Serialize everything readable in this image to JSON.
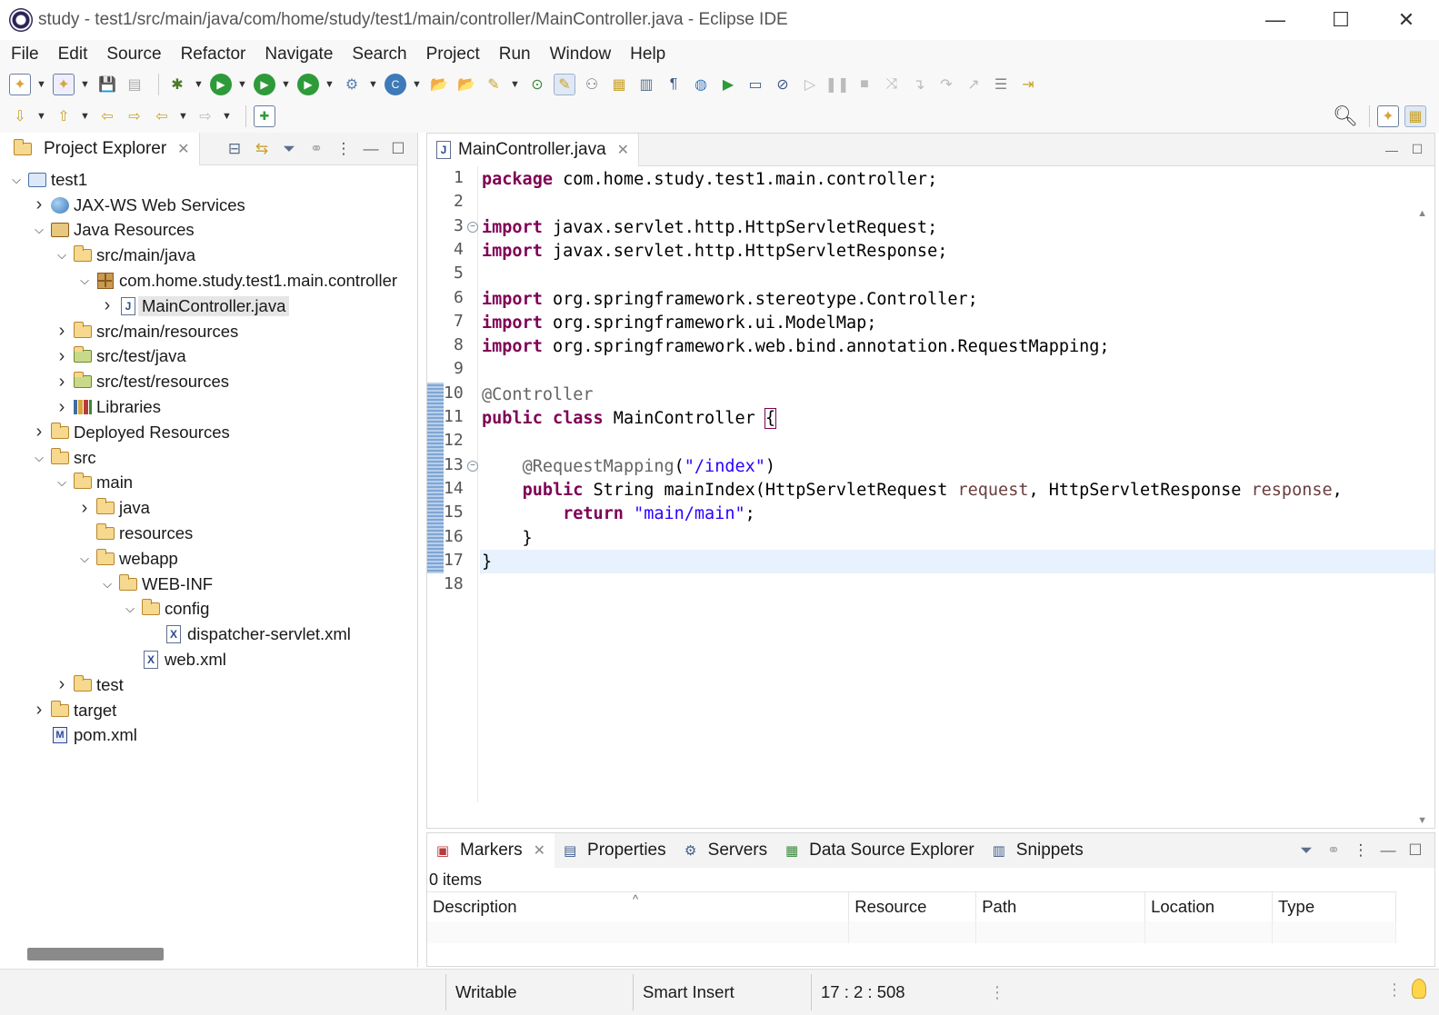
{
  "window": {
    "title": "study - test1/src/main/java/com/home/study/test1/main/controller/MainController.java - Eclipse IDE",
    "minimize": "—",
    "maximize": "☐",
    "close": "✕"
  },
  "menu": [
    "File",
    "Edit",
    "Source",
    "Refactor",
    "Navigate",
    "Search",
    "Project",
    "Run",
    "Window",
    "Help"
  ],
  "project_explorer": {
    "tab_label": "Project Explorer",
    "tree": [
      {
        "label": "test1",
        "indent": 0,
        "twisty": "open",
        "icon": "project-icon"
      },
      {
        "label": "JAX-WS Web Services",
        "indent": 1,
        "twisty": "closed",
        "icon": "web-services-icon"
      },
      {
        "label": "Java Resources",
        "indent": 1,
        "twisty": "open",
        "icon": "java-resources-icon"
      },
      {
        "label": "src/main/java",
        "indent": 2,
        "twisty": "open",
        "icon": "source-folder-icon"
      },
      {
        "label": "com.home.study.test1.main.controller",
        "indent": 3,
        "twisty": "open",
        "icon": "package-icon"
      },
      {
        "label": "MainController.java",
        "indent": 4,
        "twisty": "closed",
        "icon": "java-file-icon",
        "selected": true
      },
      {
        "label": "src/main/resources",
        "indent": 2,
        "twisty": "closed",
        "icon": "source-folder-icon"
      },
      {
        "label": "src/test/java",
        "indent": 2,
        "twisty": "closed",
        "icon": "test-source-folder-icon"
      },
      {
        "label": "src/test/resources",
        "indent": 2,
        "twisty": "closed",
        "icon": "test-source-folder-icon"
      },
      {
        "label": "Libraries",
        "indent": 2,
        "twisty": "closed",
        "icon": "libraries-icon"
      },
      {
        "label": "Deployed Resources",
        "indent": 1,
        "twisty": "closed",
        "icon": "folder-icon"
      },
      {
        "label": "src",
        "indent": 1,
        "twisty": "open",
        "icon": "folder-icon"
      },
      {
        "label": "main",
        "indent": 2,
        "twisty": "open",
        "icon": "folder-icon"
      },
      {
        "label": "java",
        "indent": 3,
        "twisty": "closed",
        "icon": "folder-icon"
      },
      {
        "label": "resources",
        "indent": 3,
        "twisty": "none",
        "icon": "folder-icon"
      },
      {
        "label": "webapp",
        "indent": 3,
        "twisty": "open",
        "icon": "folder-icon"
      },
      {
        "label": "WEB-INF",
        "indent": 4,
        "twisty": "open",
        "icon": "folder-icon"
      },
      {
        "label": "config",
        "indent": 5,
        "twisty": "open",
        "icon": "folder-icon"
      },
      {
        "label": "dispatcher-servlet.xml",
        "indent": 6,
        "twisty": "none",
        "icon": "xml-file-icon"
      },
      {
        "label": "web.xml",
        "indent": 5,
        "twisty": "none",
        "icon": "xml-file-icon"
      },
      {
        "label": "test",
        "indent": 2,
        "twisty": "closed",
        "icon": "folder-icon"
      },
      {
        "label": "target",
        "indent": 1,
        "twisty": "closed",
        "icon": "folder-icon"
      },
      {
        "label": "pom.xml",
        "indent": 1,
        "twisty": "none",
        "icon": "maven-file-icon"
      }
    ]
  },
  "editor": {
    "tab_label": "MainController.java",
    "lines": [
      {
        "n": "1",
        "fold": false,
        "tokens": [
          [
            "kw",
            "package"
          ],
          [
            "t",
            " com.home.study.test1.main.controller;"
          ]
        ]
      },
      {
        "n": "2",
        "fold": false,
        "tokens": []
      },
      {
        "n": "3",
        "fold": true,
        "tokens": [
          [
            "kw",
            "import"
          ],
          [
            "t",
            " javax.servlet.http.HttpServletRequest;"
          ]
        ]
      },
      {
        "n": "4",
        "fold": false,
        "tokens": [
          [
            "kw",
            "import"
          ],
          [
            "t",
            " javax.servlet.http.HttpServletResponse;"
          ]
        ]
      },
      {
        "n": "5",
        "fold": false,
        "tokens": []
      },
      {
        "n": "6",
        "fold": false,
        "tokens": [
          [
            "kw",
            "import"
          ],
          [
            "t",
            " org.springframework.stereotype.Controller;"
          ]
        ]
      },
      {
        "n": "7",
        "fold": false,
        "tokens": [
          [
            "kw",
            "import"
          ],
          [
            "t",
            " org.springframework.ui.ModelMap;"
          ]
        ]
      },
      {
        "n": "8",
        "fold": false,
        "tokens": [
          [
            "kw",
            "import"
          ],
          [
            "t",
            " org.springframework.web.bind.annotation.RequestMapping;"
          ]
        ]
      },
      {
        "n": "9",
        "fold": false,
        "tokens": []
      },
      {
        "n": "10",
        "fold": false,
        "tokens": [
          [
            "ann",
            "@Controller"
          ]
        ]
      },
      {
        "n": "11",
        "fold": false,
        "tokens": [
          [
            "kw",
            "public"
          ],
          [
            "t",
            " "
          ],
          [
            "kw",
            "class"
          ],
          [
            "t",
            " MainController "
          ],
          [
            "brace",
            "{"
          ]
        ]
      },
      {
        "n": "12",
        "fold": false,
        "tokens": []
      },
      {
        "n": "13",
        "fold": true,
        "tokens": [
          [
            "t",
            "    "
          ],
          [
            "ann",
            "@RequestMapping"
          ],
          [
            "t",
            "("
          ],
          [
            "str",
            "\"/index\""
          ],
          [
            "t",
            ")"
          ]
        ]
      },
      {
        "n": "14",
        "fold": false,
        "tokens": [
          [
            "t",
            "    "
          ],
          [
            "kw",
            "public"
          ],
          [
            "t",
            " String mainIndex(HttpServletRequest "
          ],
          [
            "param",
            "request"
          ],
          [
            "t",
            ", HttpServletResponse "
          ],
          [
            "param",
            "response"
          ],
          [
            "t",
            ","
          ]
        ]
      },
      {
        "n": "15",
        "fold": false,
        "tokens": [
          [
            "t",
            "        "
          ],
          [
            "kw",
            "return"
          ],
          [
            "t",
            " "
          ],
          [
            "str",
            "\"main/main\""
          ],
          [
            "t",
            ";"
          ]
        ]
      },
      {
        "n": "16",
        "fold": false,
        "tokens": [
          [
            "t",
            "    }"
          ]
        ]
      },
      {
        "n": "17",
        "fold": false,
        "tokens": [
          [
            "t",
            "}"
          ]
        ]
      },
      {
        "n": "18",
        "fold": false,
        "tokens": []
      }
    ]
  },
  "bottom_panel": {
    "tabs": [
      {
        "label": "Markers",
        "icon": "markers-icon",
        "active": true
      },
      {
        "label": "Properties",
        "icon": "properties-icon"
      },
      {
        "label": "Servers",
        "icon": "servers-icon"
      },
      {
        "label": "Data Source Explorer",
        "icon": "data-source-icon"
      },
      {
        "label": "Snippets",
        "icon": "snippets-icon"
      }
    ],
    "items_count": "0 items",
    "columns": [
      "Description",
      "Resource",
      "Path",
      "Location",
      "Type"
    ]
  },
  "status": {
    "writable": "Writable",
    "insert_mode": "Smart Insert",
    "position": "17 : 2 : 508"
  }
}
